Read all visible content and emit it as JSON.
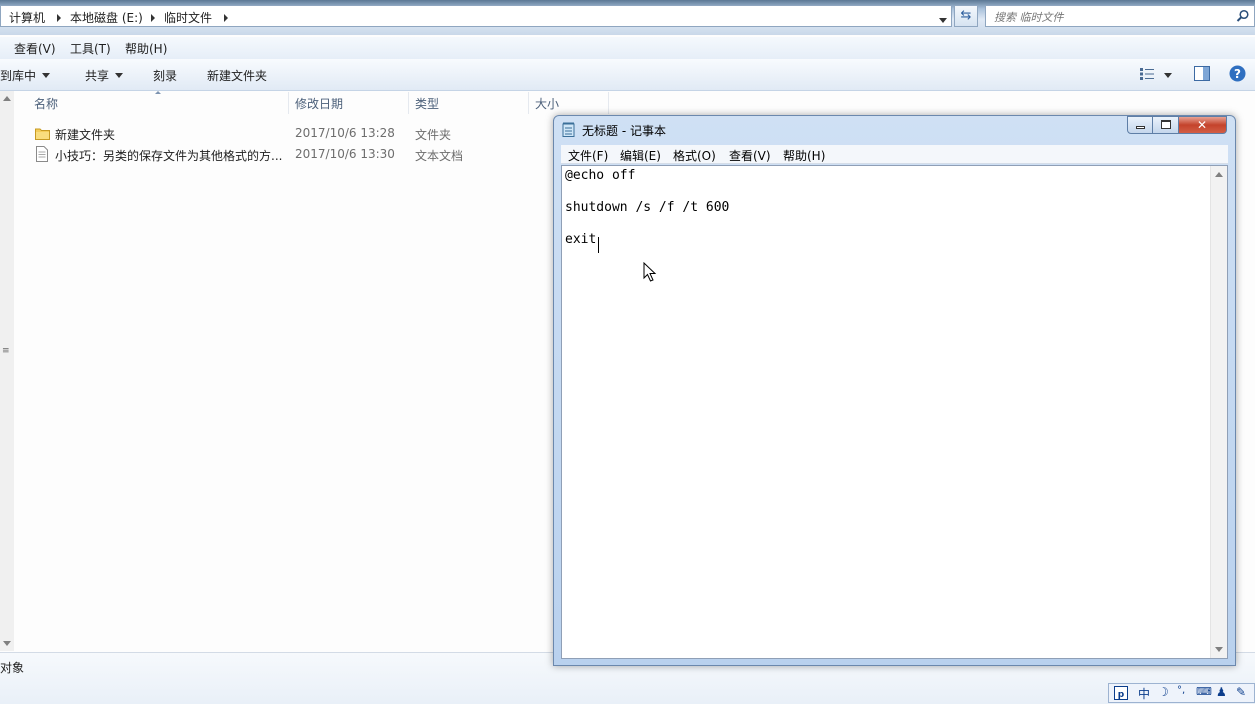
{
  "explorer": {
    "breadcrumb": [
      "计算机",
      "本地磁盘 (E:)",
      "临时文件"
    ],
    "search_placeholder": "搜索 临时文件",
    "menu": [
      "查看(V)",
      "工具(T)",
      "帮助(H)"
    ],
    "toolbar": {
      "include_library": "含到库中",
      "share": "共享",
      "burn": "刻录",
      "new_folder": "新建文件夹"
    },
    "columns": {
      "name": "名称",
      "modified": "修改日期",
      "type": "类型",
      "size": "大小"
    },
    "files": [
      {
        "name": "新建文件夹",
        "modified": "2017/10/6 13:28",
        "type": "文件夹",
        "icon": "folder-icon"
      },
      {
        "name": "小技巧：另类的保存文件为其他格式的方...",
        "modified": "2017/10/6 13:30",
        "type": "文本文档",
        "icon": "text-file-icon"
      }
    ],
    "status": "对象"
  },
  "notepad": {
    "title": "无标题 - 记事本",
    "menu": [
      "文件(F)",
      "编辑(E)",
      "格式(O)",
      "查看(V)",
      "帮助(H)"
    ],
    "lines": [
      "@echo off",
      "shutdown /s /f /t 600",
      "exit"
    ]
  },
  "tray": {
    "ime": "中"
  },
  "colors": {
    "accent": "#2e5f9e",
    "close_button": "#c4432c"
  }
}
